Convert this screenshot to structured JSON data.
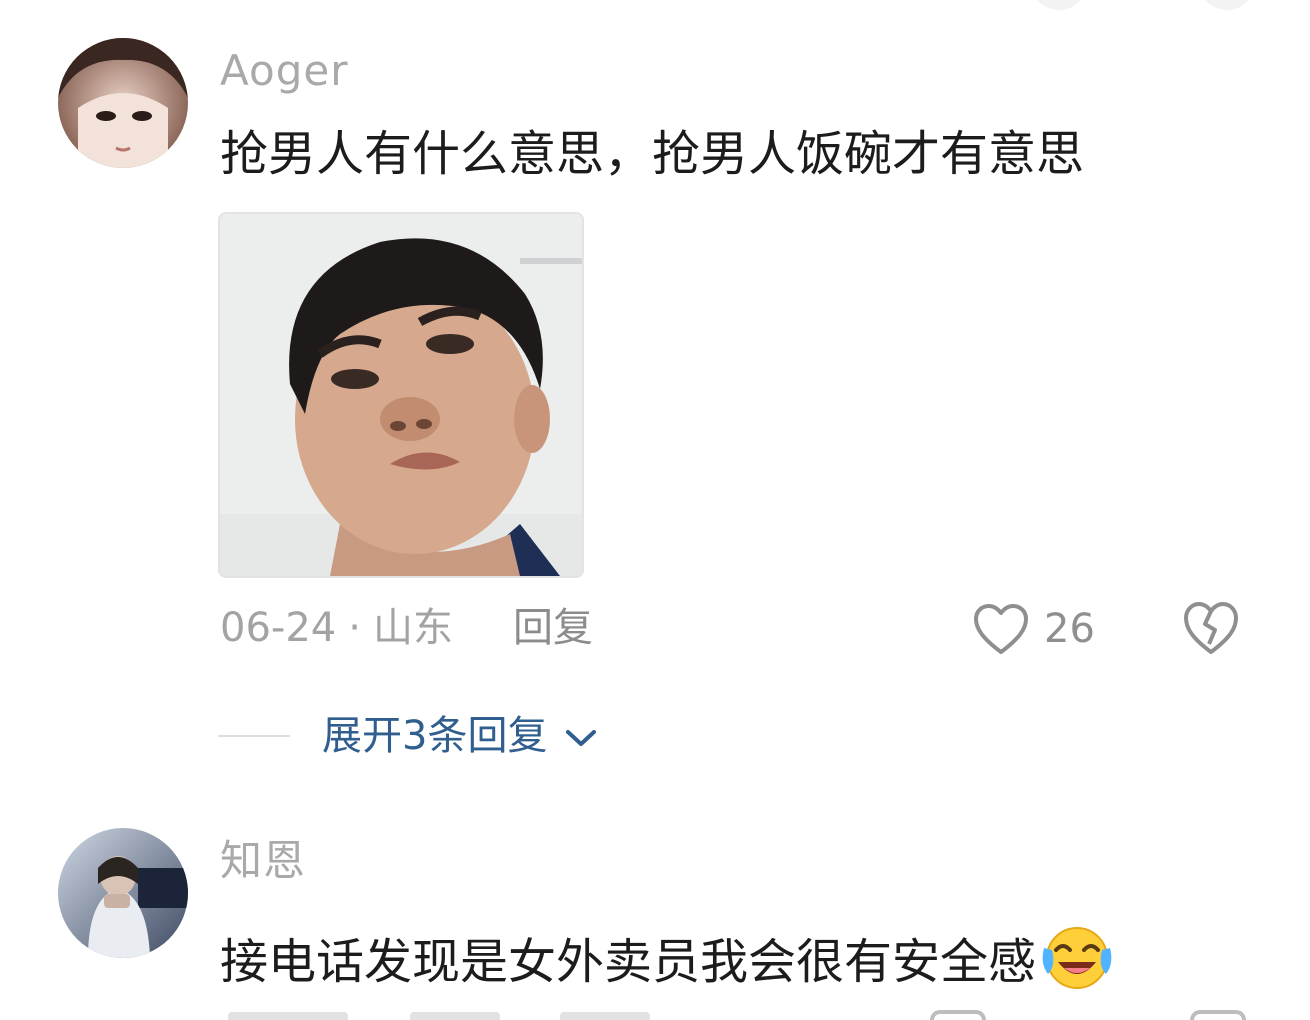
{
  "comments": [
    {
      "username": "Aoger",
      "text": "抢男人有什么意思，抢男人饭碗才有意思",
      "date": "06-24",
      "separator": "·",
      "location": "山东",
      "reply_label": "回复",
      "like_count": "26",
      "expand_label": "展开3条回复"
    },
    {
      "username": "知恩",
      "text": "接电话发现是女外卖员我会很有安全感",
      "emoji": "laughing-crying-emoji"
    }
  ],
  "icons": {
    "like": "heart-outline-icon",
    "dislike": "broken-heart-icon",
    "expand": "chevron-down-icon"
  },
  "colors": {
    "username": "#a9a9a9",
    "text": "#1c1c1c",
    "meta": "#a3a3a3",
    "link": "#2f5e8f",
    "emoji": "#ffcf3a"
  }
}
